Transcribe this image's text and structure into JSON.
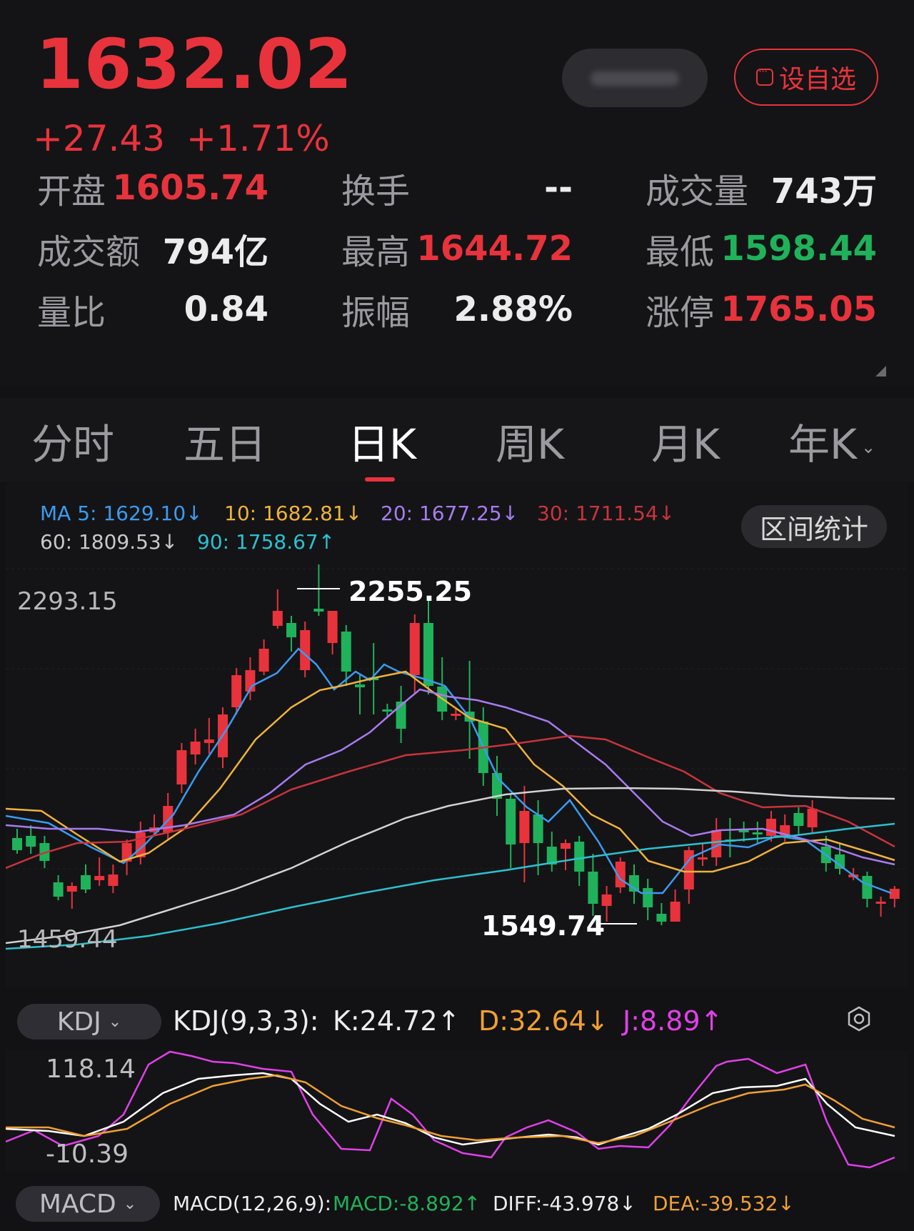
{
  "quote": {
    "price": "1632.02",
    "change": "+27.43",
    "change_pct": "+1.71%",
    "fav_label": "设自选",
    "stats": [
      {
        "label": "开盘",
        "value": "1605.74",
        "color": "red"
      },
      {
        "label": "换手",
        "value": "--",
        "color": "white"
      },
      {
        "label": "成交量",
        "value": "743万",
        "color": "white"
      },
      {
        "label": "成交额",
        "value": "794亿",
        "color": "white"
      },
      {
        "label": "最高",
        "value": "1644.72",
        "color": "red"
      },
      {
        "label": "最低",
        "value": "1598.44",
        "color": "green"
      },
      {
        "label": "量比",
        "value": "0.84",
        "color": "white"
      },
      {
        "label": "振幅",
        "value": "2.88%",
        "color": "white"
      },
      {
        "label": "涨停",
        "value": "1765.05",
        "color": "red"
      }
    ]
  },
  "tabs": [
    "分时",
    "五日",
    "日K",
    "周K",
    "月K",
    "年K"
  ],
  "active_tab": "日K",
  "ma": {
    "ma5": "MA 5: 1629.10↓",
    "ma10": "10: 1682.81↓",
    "ma20": "20: 1677.25↓",
    "ma30": "30: 1711.54↓",
    "ma60": "60: 1809.53↓",
    "ma90": "90: 1758.67↑"
  },
  "range_stats_label": "区间统计",
  "kline": {
    "top_label": "2293.15",
    "bottom_label": "1459.44",
    "high_mark": "2255.25",
    "low_mark": "1549.74"
  },
  "kdj": {
    "selector": "KDJ",
    "params": "KDJ(9,3,3):",
    "k": "K:24.72↑",
    "d": "D:32.64↓",
    "j": "J:8.89↑",
    "top": "118.14",
    "bottom": "-10.39"
  },
  "macd": {
    "selector": "MACD",
    "params": "MACD(12,26,9):",
    "macd": "MACD:-8.892↑",
    "diff": "DIFF:-43.978↓",
    "dea": "DEA:-39.532↓"
  },
  "colors": {
    "up": "#e8333c",
    "down": "#1fb25a",
    "ma5": "#3a9bf0",
    "ma10": "#f0b23a",
    "ma20": "#a77bf0",
    "ma30": "#c8343c",
    "ma60": "#d2d2d2",
    "ma90": "#2cc0d0",
    "kdj_k": "#ffffff",
    "kdj_d": "#f0a030",
    "kdj_j": "#e040e8"
  },
  "icons": {
    "favorite": "list-icon",
    "settings": "gear-icon",
    "dropdown": "chevron-down-icon"
  }
}
